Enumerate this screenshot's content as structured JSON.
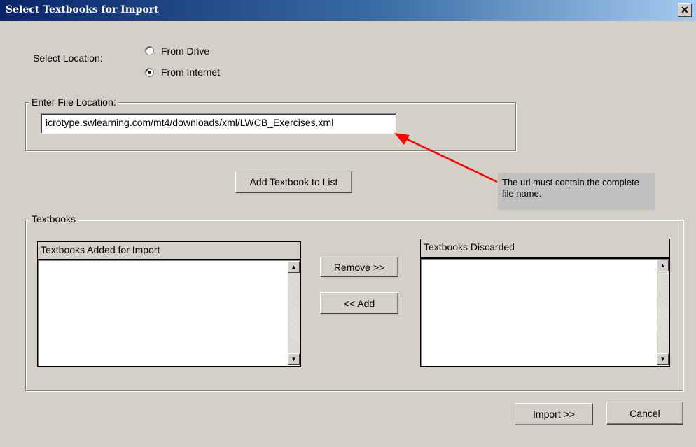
{
  "window": {
    "title": "Select Textbooks for Import",
    "close_glyph": "✕"
  },
  "location": {
    "label": "Select Location:",
    "options": [
      {
        "label": "From Drive",
        "selected": false
      },
      {
        "label": "From Internet",
        "selected": true
      }
    ]
  },
  "file_location": {
    "legend": "Enter File Location:",
    "value": "icrotype.swlearning.com/mt4/downloads/xml/LWCB_Exercises.xml"
  },
  "add_button_label": "Add Textbook to List",
  "annotation": {
    "text": "The url must contain the complete file name.",
    "arrow_color": "#ff0000"
  },
  "textbooks": {
    "legend": "Textbooks",
    "added_header": "Textbooks Added for Import",
    "discarded_header": "Textbooks Discarded",
    "added_items": [],
    "discarded_items": [],
    "remove_label": "Remove >>",
    "add_label": "<< Add"
  },
  "footer": {
    "import_label": "Import >>",
    "cancel_label": "Cancel"
  },
  "icons": {
    "scroll_up": "▲",
    "scroll_down": "▼"
  }
}
